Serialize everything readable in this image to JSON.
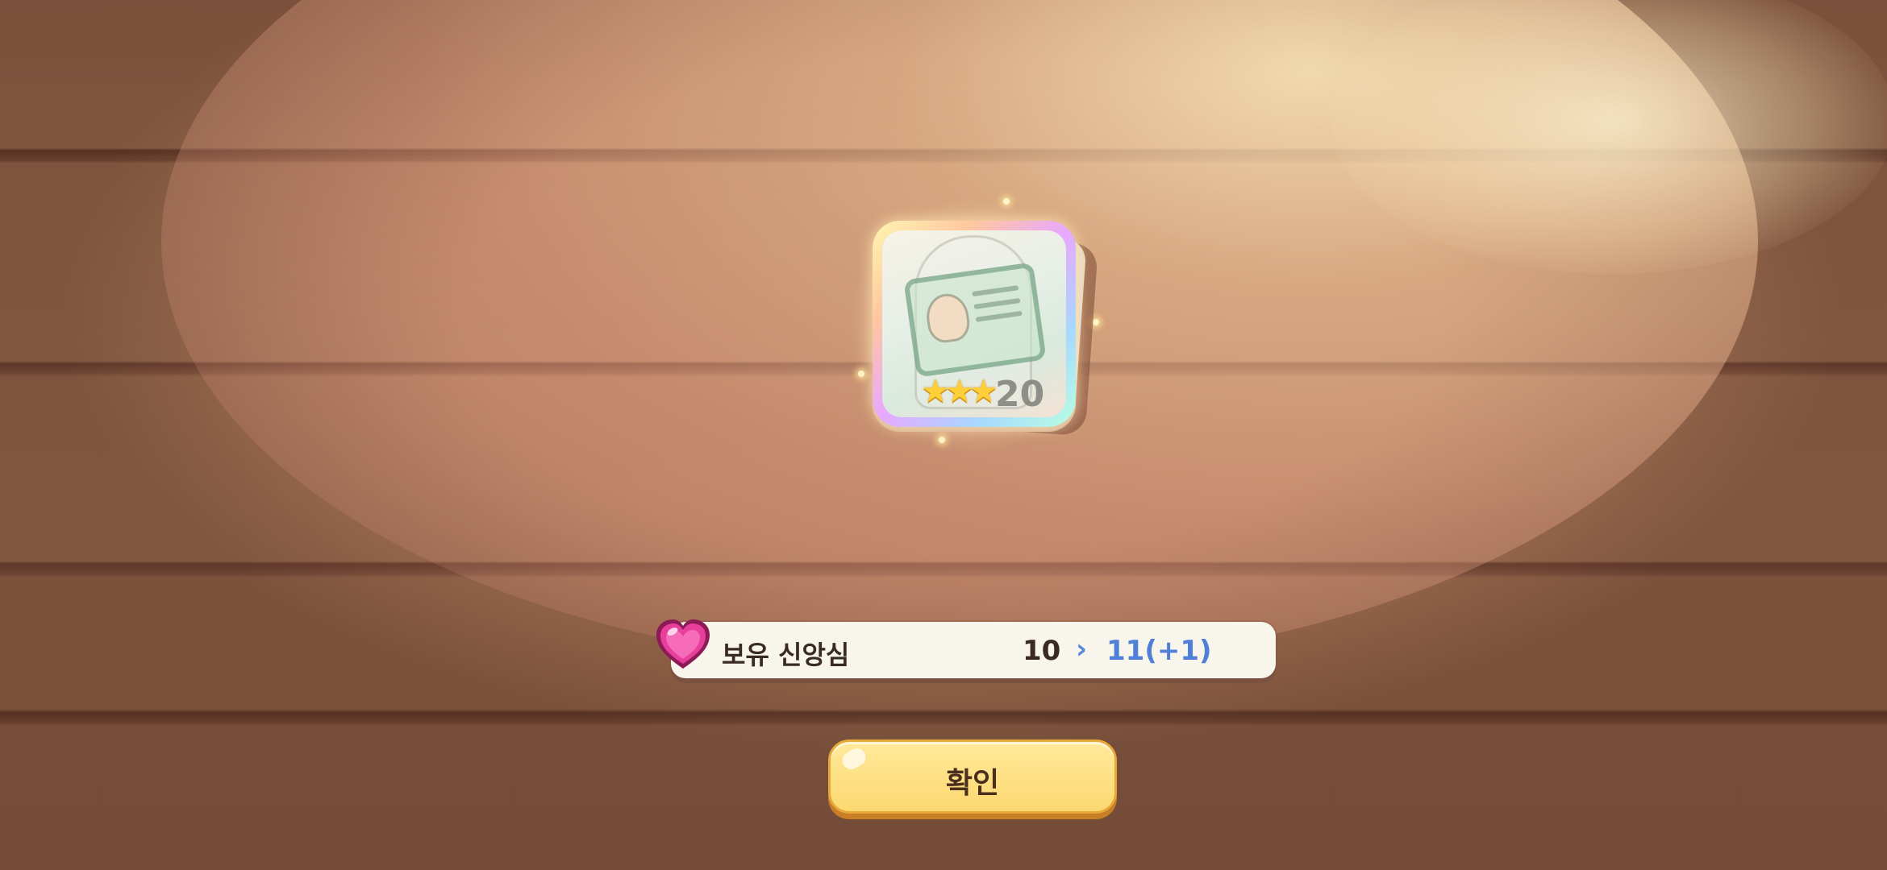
{
  "reward_card": {
    "stars": "★★★",
    "number": "20"
  },
  "info_bar": {
    "icon": "heart-gem-icon",
    "label": "보유 신앙심",
    "old_value": "10",
    "arrow": "›",
    "new_value": "11(+1)"
  },
  "confirm": {
    "label": "확인"
  },
  "colors": {
    "accent_blue": "#4f7fd6",
    "button_yellow": "#fcd870",
    "heart_pink": "#e83f9c"
  }
}
